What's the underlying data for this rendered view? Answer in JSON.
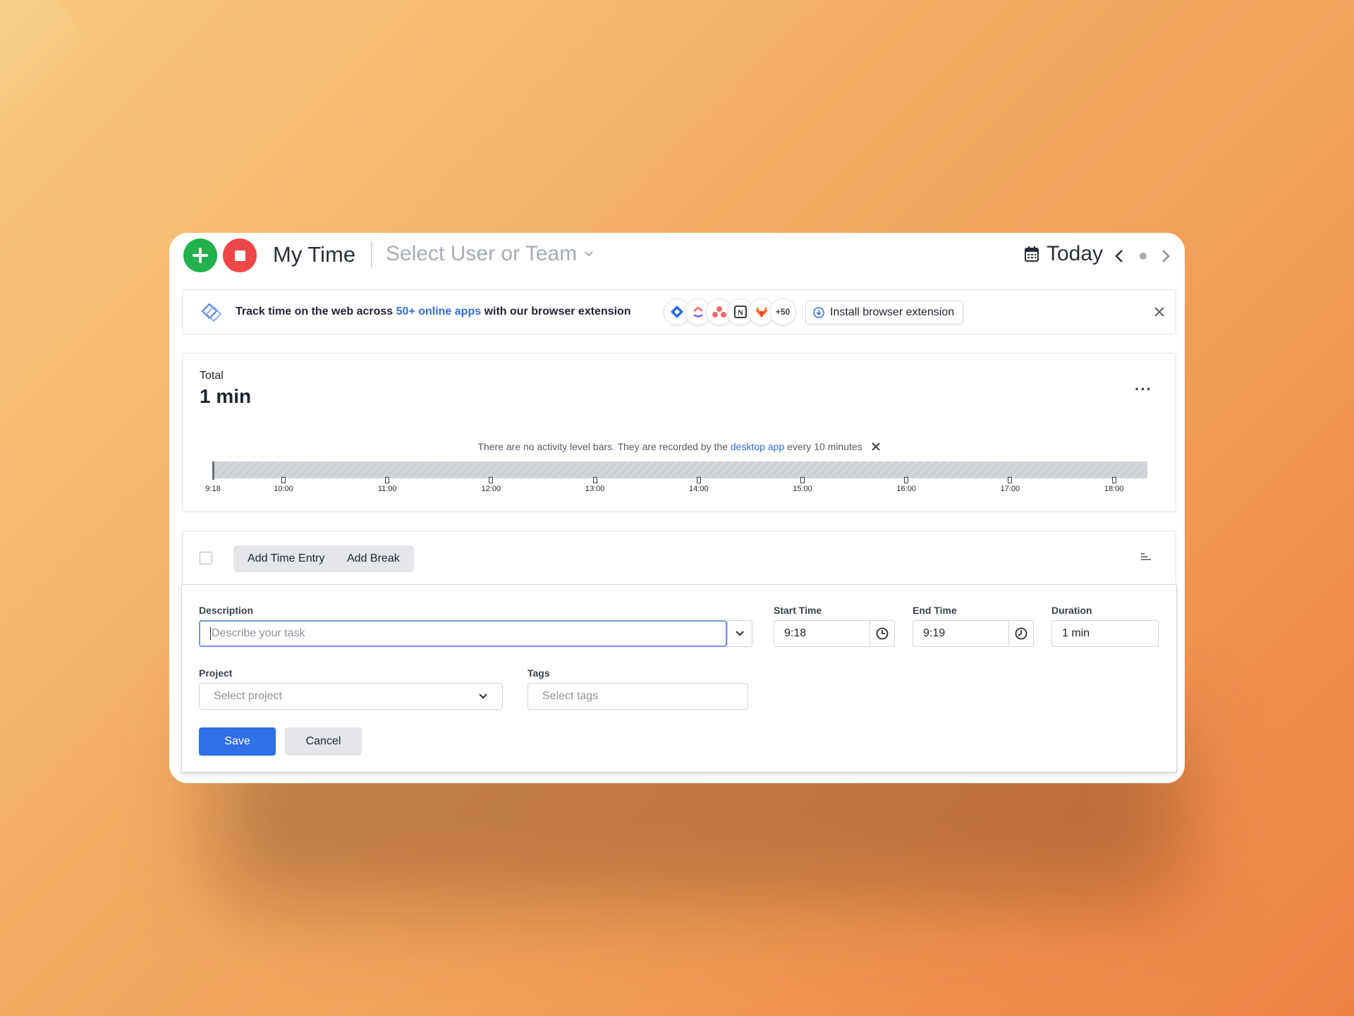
{
  "header": {
    "title": "My Time",
    "user_select": "Select User or Team",
    "date_label": "Today"
  },
  "banner": {
    "text_before": "Track time on the web across ",
    "link_text": "50+ online apps",
    "text_after": " with our browser extension",
    "apps": [
      "jira-icon",
      "clickup-icon",
      "asana-icon",
      "notion-icon",
      "gitlab-icon"
    ],
    "more_count": "+50",
    "install_label": "Install browser extension"
  },
  "summary": {
    "total_label": "Total",
    "total_value": "1 min",
    "activity_note_before": "There are no activity level bars. They are recorded by the ",
    "activity_note_link": "desktop app",
    "activity_note_after": " every 10 minutes",
    "timeline_ticks": [
      "9:18",
      "10:00",
      "11:00",
      "12:00",
      "13:00",
      "14:00",
      "15:00",
      "16:00",
      "17:00",
      "18:00"
    ]
  },
  "actions": {
    "add_entry": "Add Time Entry",
    "add_break": "Add Break"
  },
  "form": {
    "description_label": "Description",
    "description_placeholder": "Describe your task",
    "start_label": "Start Time",
    "start_value": "9:18",
    "end_label": "End Time",
    "end_value": "9:19",
    "duration_label": "Duration",
    "duration_value": "1 min",
    "project_label": "Project",
    "project_placeholder": "Select project",
    "tags_label": "Tags",
    "tags_placeholder": "Select tags",
    "save_label": "Save",
    "cancel_label": "Cancel"
  },
  "colors": {
    "accent_blue": "#2f6fe8",
    "add_green": "#22b14c",
    "stop_red": "#ef4747"
  }
}
